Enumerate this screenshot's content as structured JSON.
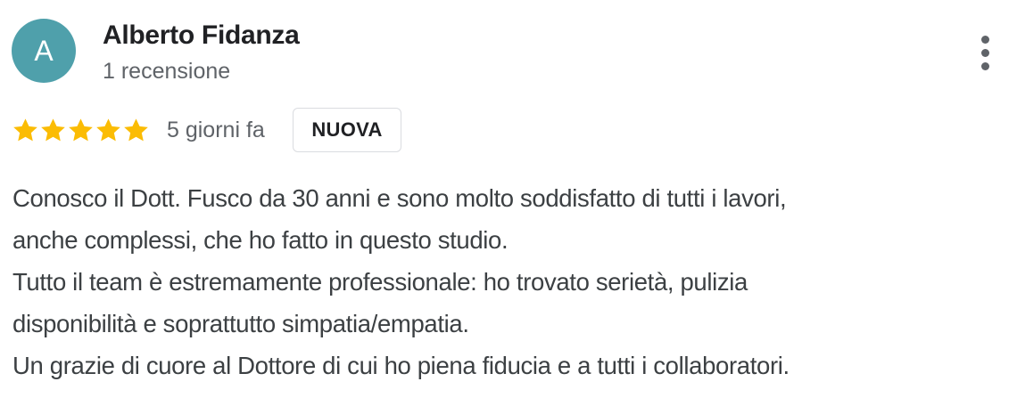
{
  "review": {
    "author": {
      "initial": "A",
      "name": "Alberto Fidanza",
      "reviews_count": "1 recensione",
      "avatar_color": "#4fa0ab"
    },
    "menu_icon": "more-vertical-icon",
    "rating": {
      "stars": 5,
      "max": 5,
      "star_color": "#fbbc04"
    },
    "date": "5 giorni fa",
    "badge": "NUOVA",
    "text_lines": [
      "Conosco il Dott. Fusco da 30 anni e sono molto soddisfatto di tutti i lavori,",
      "anche complessi, che ho fatto in questo studio.",
      "Tutto il team è estremamente professionale: ho trovato serietà, pulizia",
      "disponibilità e soprattutto simpatia/empatia.",
      "Un grazie di cuore al Dottore di cui ho piena fiducia e a tutti i collaboratori."
    ]
  }
}
